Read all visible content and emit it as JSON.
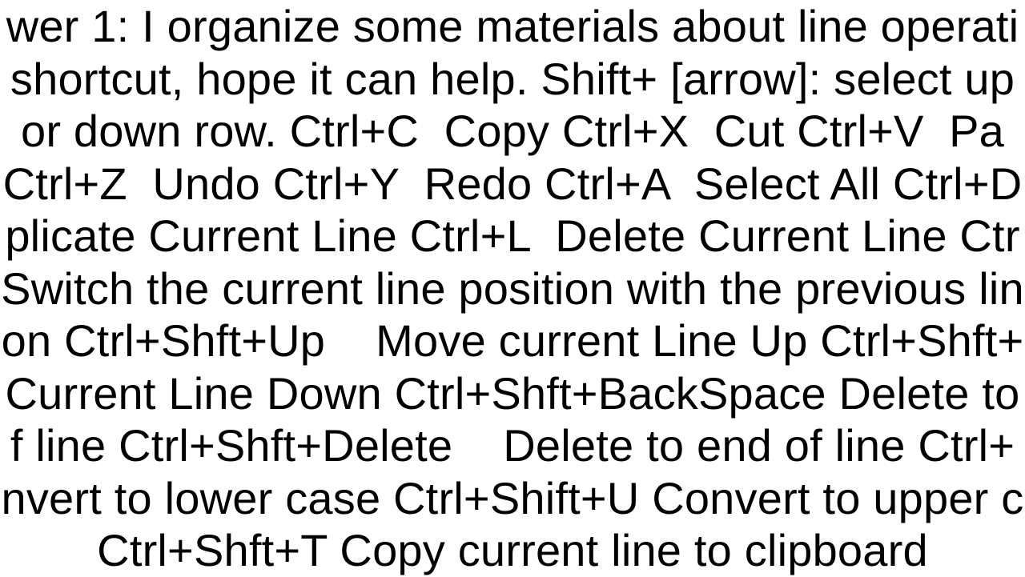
{
  "doc": {
    "text": "wer 1: I organize some materials about line operati\nshortcut, hope it can help. Shift+ [arrow]: select up\nor down row. Ctrl+C  Copy Ctrl+X  Cut Ctrl+V  Pa\nCtrl+Z  Undo Ctrl+Y  Redo Ctrl+A  Select All Ctrl+D\nplicate Current Line Ctrl+L  Delete Current Line Ctr\nSwitch the current line position with the previous lin\non Ctrl+Shft+Up    Move current Line Up Ctrl+Shft+\nCurrent Line Down Ctrl+Shft+BackSpace Delete to\nf line Ctrl+Shft+Delete    Delete to end of line Ctrl+\nnvert to lower case Ctrl+Shift+U Convert to upper c\nCtrl+Shft+T Copy current line to clipboard"
  }
}
